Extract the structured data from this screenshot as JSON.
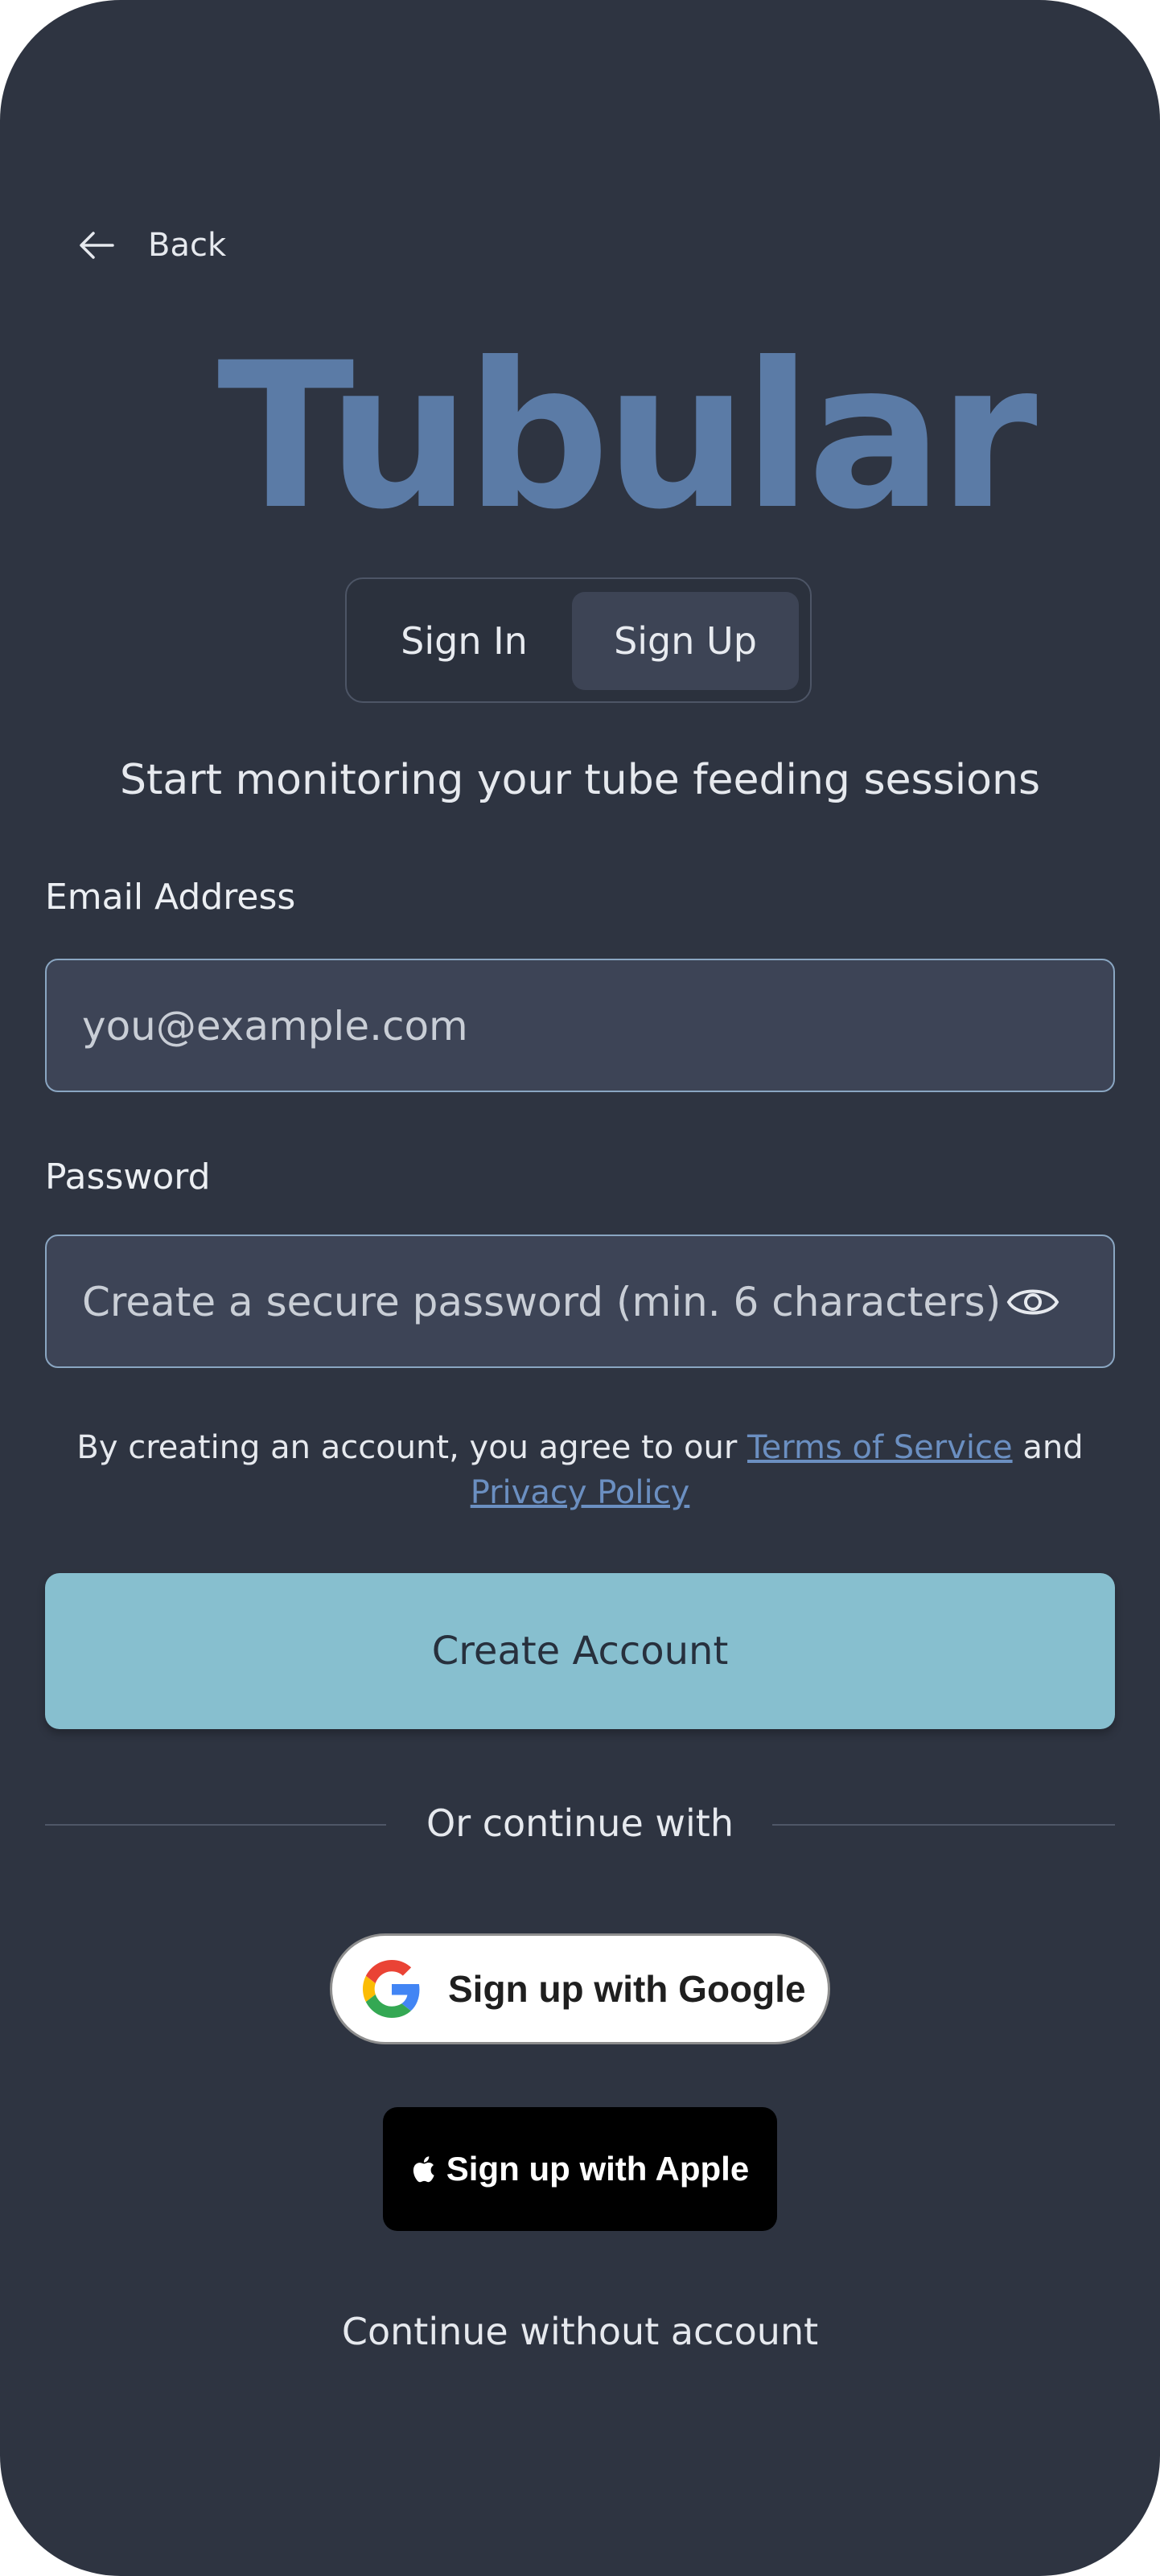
{
  "nav": {
    "back_label": "Back"
  },
  "brand": {
    "logo_text": "Tubular",
    "color": "#5b7ba6"
  },
  "auth_tabs": {
    "sign_in": "Sign In",
    "sign_up": "Sign Up",
    "selected": "Sign Up"
  },
  "subtitle": "Start monitoring your tube feeding sessions",
  "email": {
    "label": "Email Address",
    "placeholder": "you@example.com",
    "value": ""
  },
  "password": {
    "label": "Password",
    "placeholder": "Create a secure password (min. 6 characters)",
    "value": "",
    "toggle_icon": "eye-icon"
  },
  "terms": {
    "prefix": "By creating an account, you agree to our",
    "tos_link": "Terms of Service",
    "conjunction": "and",
    "privacy_link": "Privacy Policy"
  },
  "primary_button": {
    "label": "Create Account",
    "color": "#87bfcf"
  },
  "divider": {
    "label": "Or continue with"
  },
  "google_button": {
    "label": "Sign up with Google",
    "icon": "google-g-icon"
  },
  "apple_button": {
    "label": "Sign up with Apple",
    "icon": "apple-icon"
  },
  "guest_link": {
    "label": "Continue without account"
  },
  "colors": {
    "background": "#2e3441",
    "field_bg": "#3d4456",
    "field_border": "#8aa6c2",
    "link": "#6b8fc1"
  }
}
